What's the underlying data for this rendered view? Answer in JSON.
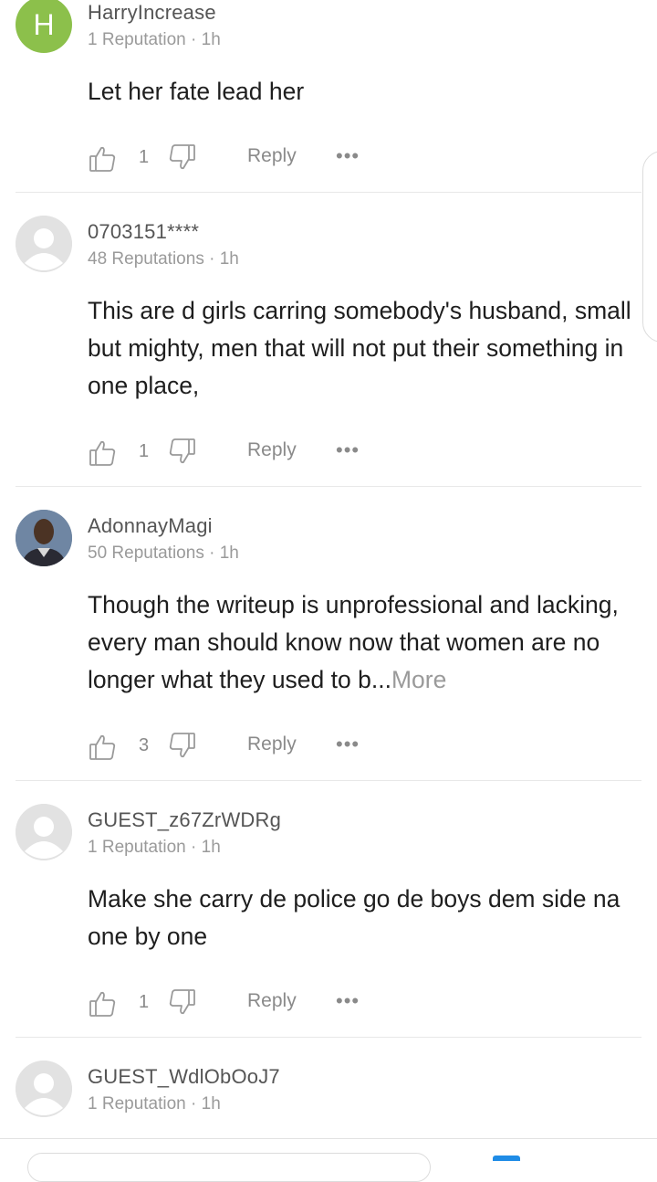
{
  "comments": [
    {
      "avatar_type": "letter",
      "avatar_letter": "H",
      "avatar_color": "#8cc04b",
      "username": "HarryIncrease",
      "reputation": "1 Reputation",
      "time": "1h",
      "body": "Let her fate lead her",
      "more": "",
      "likes": "1",
      "reply": "Reply",
      "more_options": "•••"
    },
    {
      "avatar_type": "default",
      "username": "0703151****",
      "reputation": "48 Reputations",
      "time": "1h",
      "body": "This are d girls carring somebody's husband, small but mighty, men that will not put their something in one place,",
      "more": "",
      "likes": "1",
      "reply": "Reply",
      "more_options": "•••"
    },
    {
      "avatar_type": "photo",
      "username": "AdonnayMagi",
      "reputation": "50 Reputations",
      "time": "1h",
      "body": "Though the writeup is unprofessional and lacking,  every man should know now that women are no longer what they used to b...",
      "more": "More",
      "likes": "3",
      "reply": "Reply",
      "more_options": "•••"
    },
    {
      "avatar_type": "default",
      "username": "GUEST_z67ZrWDRg",
      "reputation": "1 Reputation",
      "time": "1h",
      "body": "Make she carry de police go de boys dem side na one by one",
      "more": "",
      "likes": "1",
      "reply": "Reply",
      "more_options": "•••"
    },
    {
      "avatar_type": "default",
      "username": "GUEST_WdlObOoJ7",
      "reputation": "1 Reputation",
      "time": "1h"
    }
  ],
  "separator": "·",
  "colors": {
    "text": "#1e1e1e",
    "muted": "#9a9a9a",
    "accent": "#1f8ce6"
  }
}
